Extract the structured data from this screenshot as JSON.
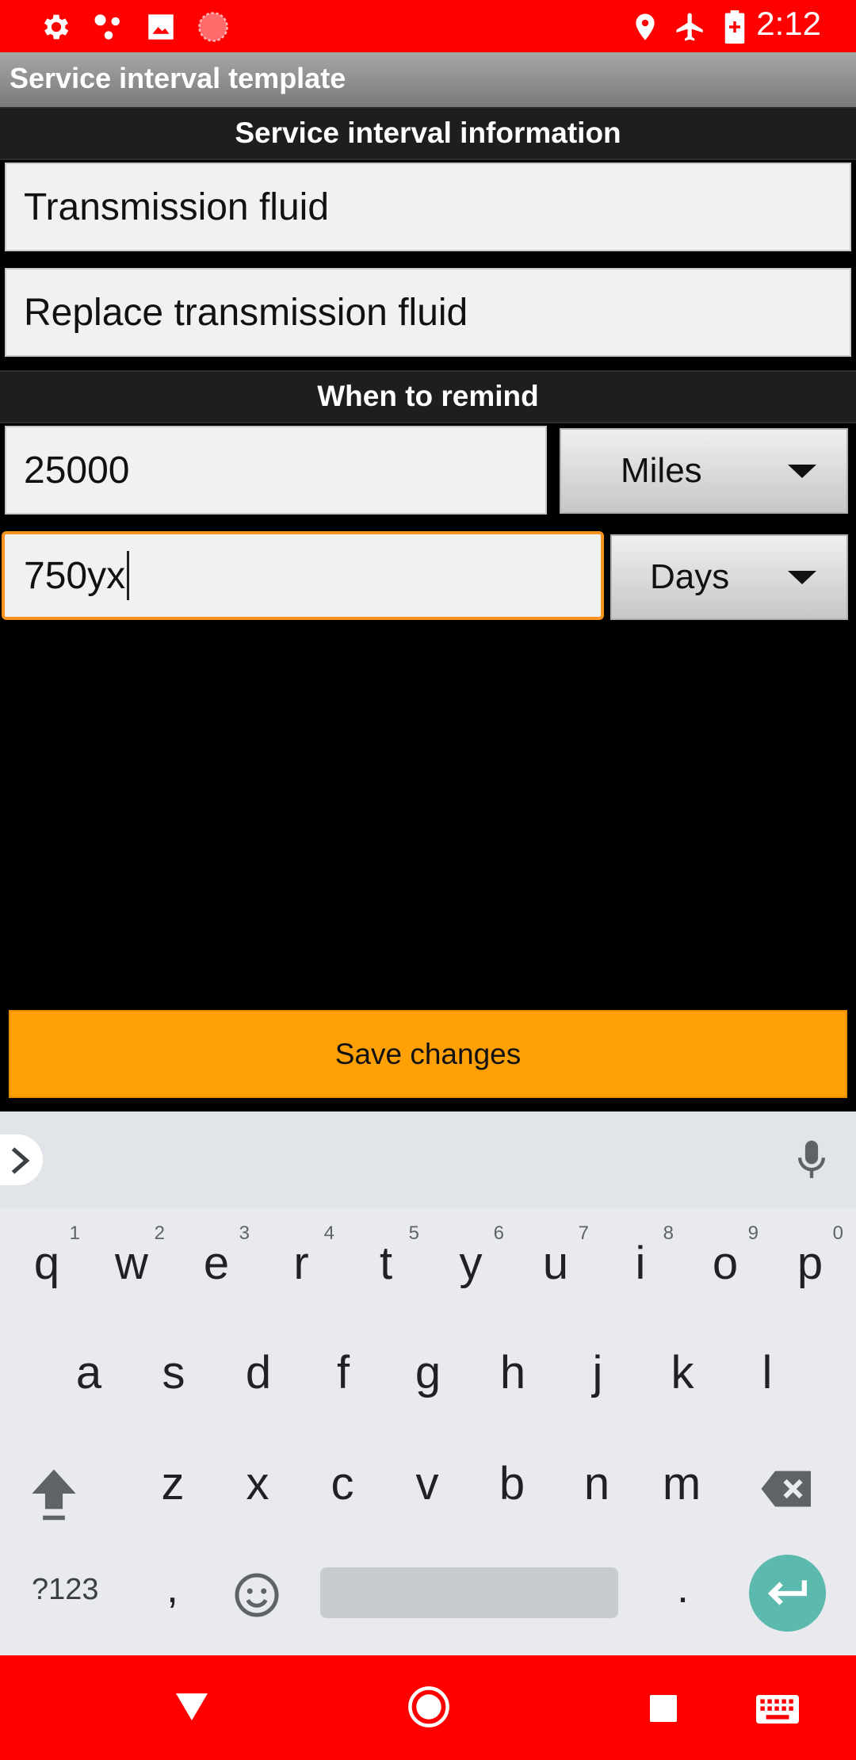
{
  "status_bar": {
    "time": "2:12",
    "left_icons": [
      "settings-icon",
      "network-dots-icon",
      "image-icon",
      "record-icon"
    ],
    "right_icons": [
      "location-icon",
      "airplane-mode-icon",
      "battery-icon"
    ],
    "color": "#ff0000"
  },
  "app": {
    "title": "Service interval template"
  },
  "section_info": {
    "header": "Service interval information",
    "name_value": "Transmission fluid",
    "description_value": "Replace transmission fluid"
  },
  "section_remind": {
    "header": "When to remind",
    "distance_value": "25000",
    "distance_unit": "Miles",
    "time_value": "750yx",
    "time_unit": "Days"
  },
  "actions": {
    "save_label": "Save changes",
    "accent": "#ffa106"
  },
  "keyboard": {
    "row1": [
      {
        "k": "q",
        "h": "1"
      },
      {
        "k": "w",
        "h": "2"
      },
      {
        "k": "e",
        "h": "3"
      },
      {
        "k": "r",
        "h": "4"
      },
      {
        "k": "t",
        "h": "5"
      },
      {
        "k": "y",
        "h": "6"
      },
      {
        "k": "u",
        "h": "7"
      },
      {
        "k": "i",
        "h": "8"
      },
      {
        "k": "o",
        "h": "9"
      },
      {
        "k": "p",
        "h": "0"
      }
    ],
    "row2": [
      "a",
      "s",
      "d",
      "f",
      "g",
      "h",
      "j",
      "k",
      "l"
    ],
    "row3": [
      "z",
      "x",
      "c",
      "v",
      "b",
      "n",
      "m"
    ],
    "symbols_label": "?123",
    "comma": ",",
    "period": ".",
    "enter_color": "#5bb9ae"
  },
  "nav_bar": {
    "icons": [
      "back-triangle-icon",
      "home-circle-icon",
      "recents-square-icon",
      "keyboard-icon"
    ],
    "color": "#ff0000"
  }
}
